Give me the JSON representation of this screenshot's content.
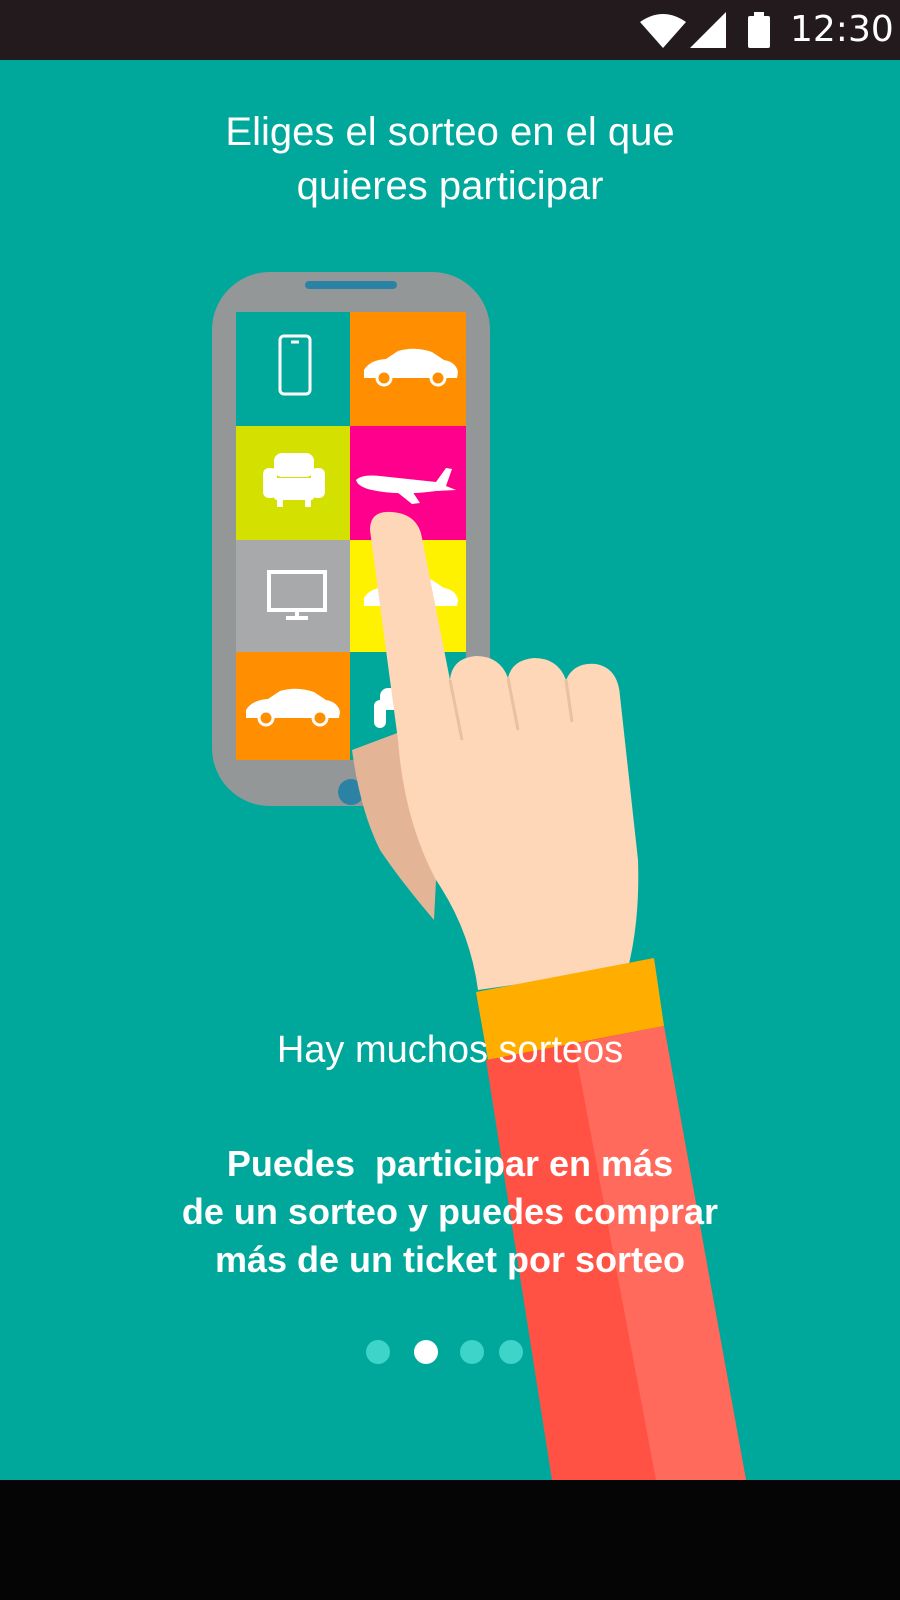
{
  "colors": {
    "background": "#00a89b",
    "status_bar": "#231a1e",
    "navigation_bar": "#050505",
    "dot_inactive": "#3ed4ca",
    "dot_active": "#ffffff"
  },
  "status_bar": {
    "time": "12:30",
    "icons": [
      "wifi-icon",
      "cell-signal-icon",
      "battery-icon"
    ]
  },
  "onboarding": {
    "heading_lines": [
      "Eliges el sorteo en el que",
      "quieres participar"
    ],
    "subtitle": "Hay muchos sorteos",
    "description_lines": [
      "Puedes  participar en más",
      "de un sorteo y puedes comprar",
      "más de un ticket por sorteo"
    ],
    "illustration_tiles": [
      "smartphone-icon",
      "car-icon",
      "armchair-icon",
      "airplane-icon",
      "tv-icon",
      "car-icon",
      "car-icon",
      "armchair-icon"
    ],
    "pager": {
      "page_count": 4,
      "current_page": 2
    }
  }
}
